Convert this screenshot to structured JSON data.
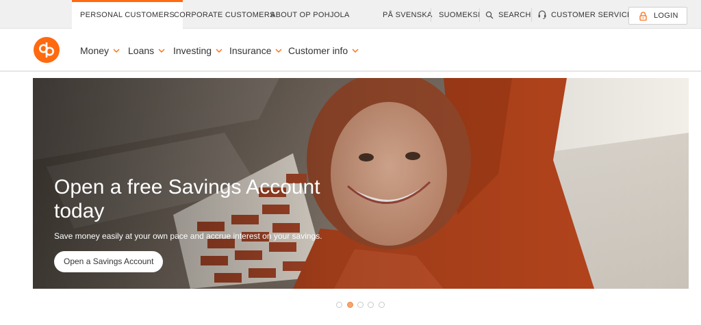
{
  "topbar": {
    "tabs": [
      {
        "label": "PERSONAL CUSTOMERS",
        "active": true
      },
      {
        "label": "CORPORATE CUSTOMERS",
        "active": false
      },
      {
        "label": "ABOUT OP POHJOLA",
        "active": false
      }
    ],
    "utility": {
      "swedish": "PÅ SVENSKA",
      "finnish": "SUOMEKSI",
      "search": "SEARCH",
      "customer_service": "CUSTOMER SERVICE",
      "login": "LOGIN"
    }
  },
  "nav": {
    "items": [
      {
        "label": "Money"
      },
      {
        "label": "Loans"
      },
      {
        "label": "Investing"
      },
      {
        "label": "Insurance"
      },
      {
        "label": "Customer info"
      }
    ]
  },
  "hero": {
    "title": "Open a free Savings Account today",
    "subtitle": "Save money easily at your own pace and accrue interest on your savings.",
    "cta": "Open a Savings Account"
  },
  "carousel": {
    "count": 5,
    "active_index": 1
  },
  "colors": {
    "brand": "#ff6a10",
    "topbar_bg": "#f0f0f0",
    "dot_active": "#f7a46b"
  }
}
